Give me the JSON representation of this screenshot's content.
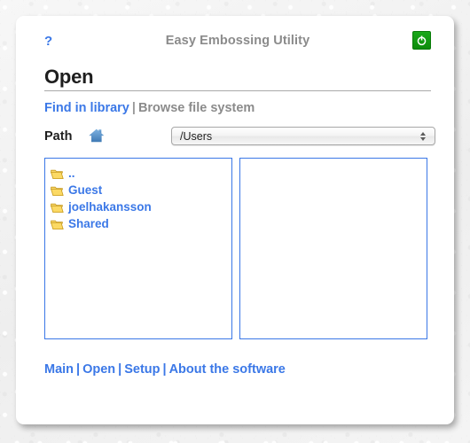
{
  "window": {
    "app_title": "Easy Embossing Utility"
  },
  "header": {
    "help_label": "?",
    "power_icon": "power-icon",
    "power_title": "Shut down"
  },
  "page": {
    "heading": "Open"
  },
  "modes": {
    "find_in_library": "Find in library",
    "separator": "|",
    "browse_file_system": "Browse file system"
  },
  "path": {
    "label": "Path",
    "home_icon": "home-icon",
    "selected": "/Users"
  },
  "file_browser": {
    "left_pane": {
      "items": [
        {
          "name": "..",
          "icon": "folder-icon"
        },
        {
          "name": "Guest",
          "icon": "folder-icon"
        },
        {
          "name": "joelhakansson",
          "icon": "folder-icon"
        },
        {
          "name": "Shared",
          "icon": "folder-icon"
        }
      ]
    },
    "right_pane": {
      "items": []
    }
  },
  "footer": {
    "links": [
      "Main",
      "Open",
      "Setup",
      "About the software"
    ],
    "separator": "|"
  },
  "colors": {
    "link_blue": "#3b78e7",
    "muted_gray": "#8b8b8b",
    "power_green": "#0d8c0b",
    "folder_yellow": "#f5c94c"
  }
}
